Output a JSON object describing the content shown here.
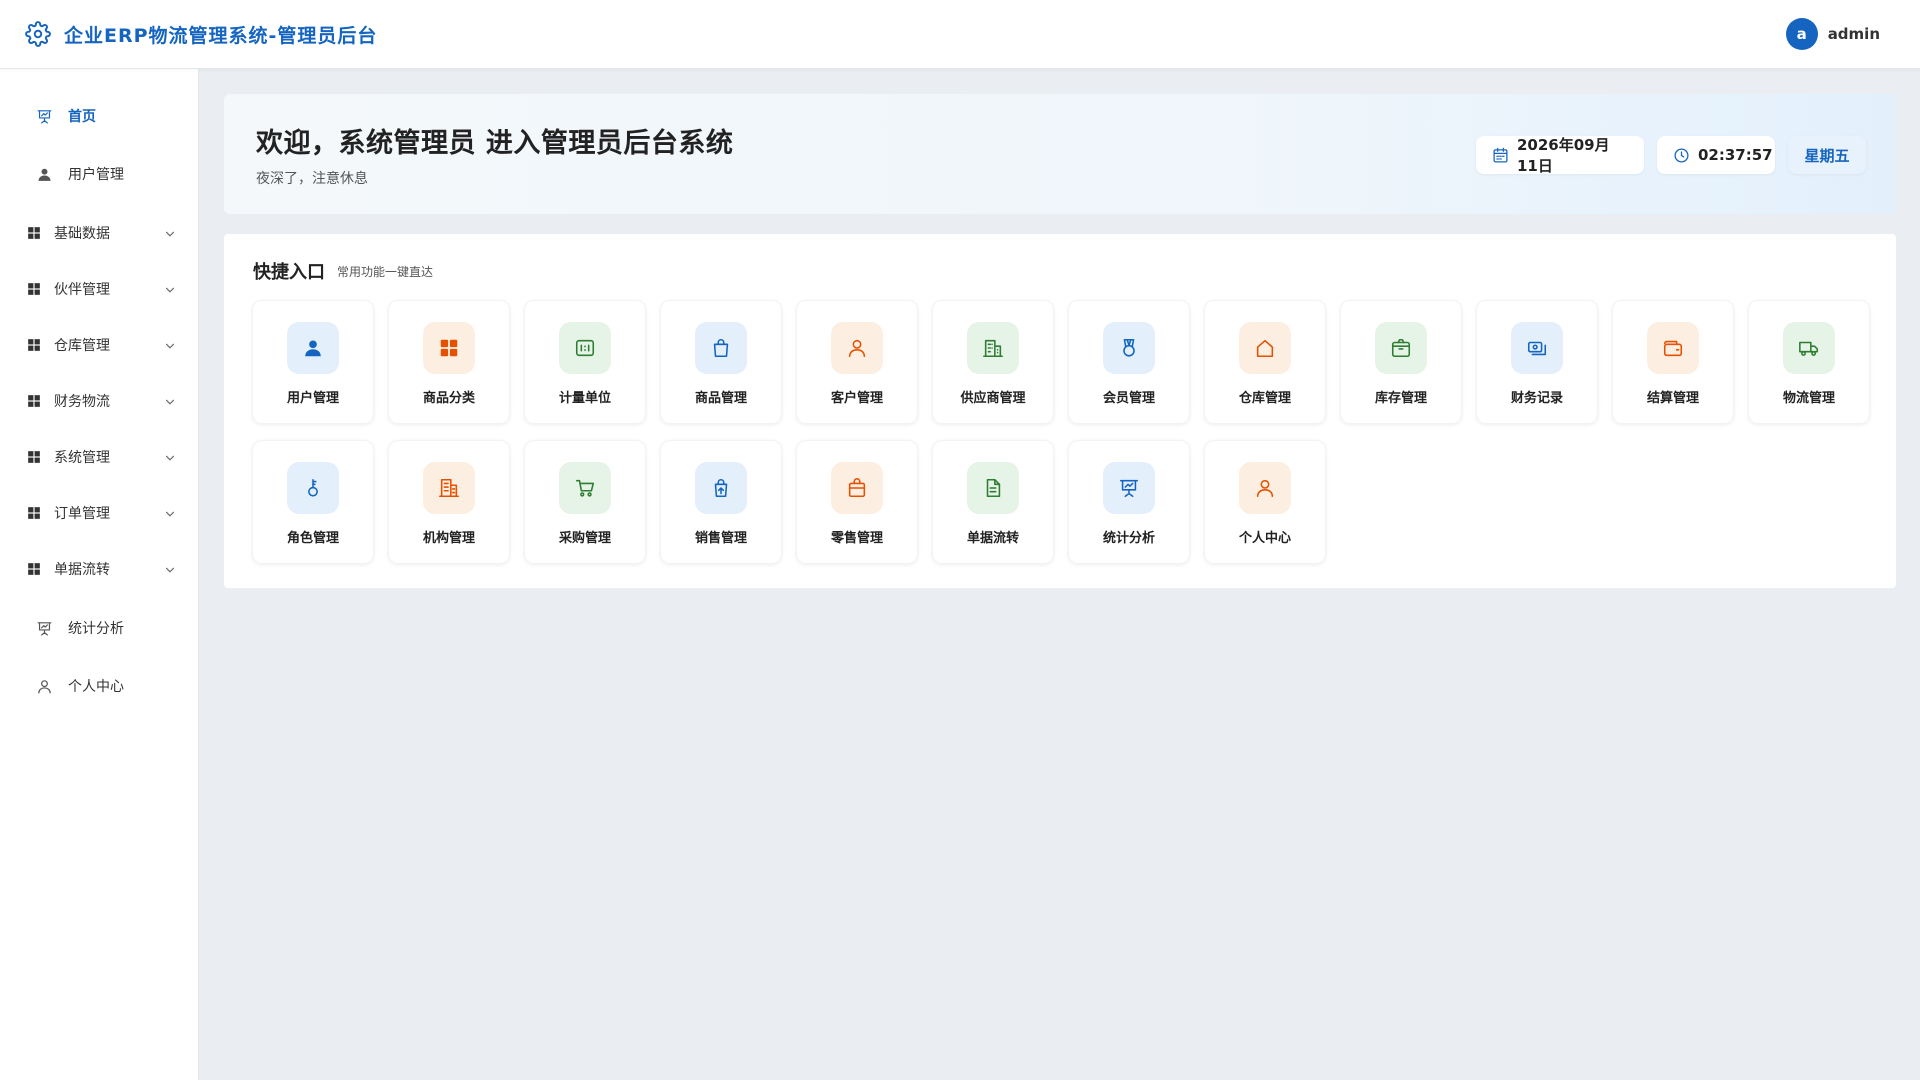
{
  "header": {
    "title": "企业ERP物流管理系统-管理员后台",
    "avatar_letter": "a",
    "username": "admin"
  },
  "sidebar": {
    "items": [
      {
        "label": "首页",
        "icon": "presentation-icon",
        "type": "leaf",
        "active": true
      },
      {
        "label": "用户管理",
        "icon": "user-icon",
        "type": "leaf"
      },
      {
        "label": "基础数据",
        "icon": "grid-icon",
        "type": "group"
      },
      {
        "label": "伙伴管理",
        "icon": "grid-icon",
        "type": "group"
      },
      {
        "label": "仓库管理",
        "icon": "grid-icon",
        "type": "group"
      },
      {
        "label": "财务物流",
        "icon": "grid-icon",
        "type": "group"
      },
      {
        "label": "系统管理",
        "icon": "grid-icon",
        "type": "group"
      },
      {
        "label": "订单管理",
        "icon": "grid-icon",
        "type": "group"
      },
      {
        "label": "单据流转",
        "icon": "grid-icon",
        "type": "group"
      },
      {
        "label": "统计分析",
        "icon": "presentation-icon",
        "type": "leaf"
      },
      {
        "label": "个人中心",
        "icon": "user-outline-icon",
        "type": "leaf"
      }
    ]
  },
  "welcome": {
    "title": "欢迎，系统管理员 进入管理员后台系统",
    "subtitle": "夜深了，注意休息",
    "date": "2026年09月11日",
    "time": "02:37:57",
    "weekday": "星期五"
  },
  "quick": {
    "title": "快捷入口",
    "subtitle": "常用功能一键直达",
    "cards": [
      {
        "label": "用户管理",
        "icon": "user-icon",
        "color": "blue"
      },
      {
        "label": "商品分类",
        "icon": "grid-icon",
        "color": "orange"
      },
      {
        "label": "计量单位",
        "icon": "ratio-icon",
        "color": "green"
      },
      {
        "label": "商品管理",
        "icon": "shopping-bag-icon",
        "color": "blue"
      },
      {
        "label": "客户管理",
        "icon": "person-outline-icon",
        "color": "orange"
      },
      {
        "label": "供应商管理",
        "icon": "building-icon",
        "color": "green"
      },
      {
        "label": "会员管理",
        "icon": "medal-icon",
        "color": "blue"
      },
      {
        "label": "仓库管理",
        "icon": "house-icon",
        "color": "orange"
      },
      {
        "label": "库存管理",
        "icon": "package-icon",
        "color": "green"
      },
      {
        "label": "财务记录",
        "icon": "money-icon",
        "color": "blue"
      },
      {
        "label": "结算管理",
        "icon": "wallet-icon",
        "color": "orange"
      },
      {
        "label": "物流管理",
        "icon": "truck-icon",
        "color": "green"
      },
      {
        "label": "角色管理",
        "icon": "key-icon",
        "color": "blue"
      },
      {
        "label": "机构管理",
        "icon": "office-building-icon",
        "color": "orange"
      },
      {
        "label": "采购管理",
        "icon": "shopping-cart-icon",
        "color": "green"
      },
      {
        "label": "销售管理",
        "icon": "bag-upload-icon",
        "color": "blue"
      },
      {
        "label": "零售管理",
        "icon": "briefcase-bag-icon",
        "color": "orange"
      },
      {
        "label": "单据流转",
        "icon": "document-icon",
        "color": "green"
      },
      {
        "label": "统计分析",
        "icon": "presentation-icon",
        "color": "blue"
      },
      {
        "label": "个人中心",
        "icon": "person-outline-icon",
        "color": "orange"
      }
    ]
  },
  "colors": {
    "primary": "#1565c0",
    "blue_icon": "#1565c0",
    "orange_icon": "#e65100",
    "green_icon": "#2e7d32",
    "blue_bg": "#e3f0fc",
    "orange_bg": "#fdeee2",
    "green_bg": "#e6f3e7",
    "page_bg": "#eaeef2"
  }
}
